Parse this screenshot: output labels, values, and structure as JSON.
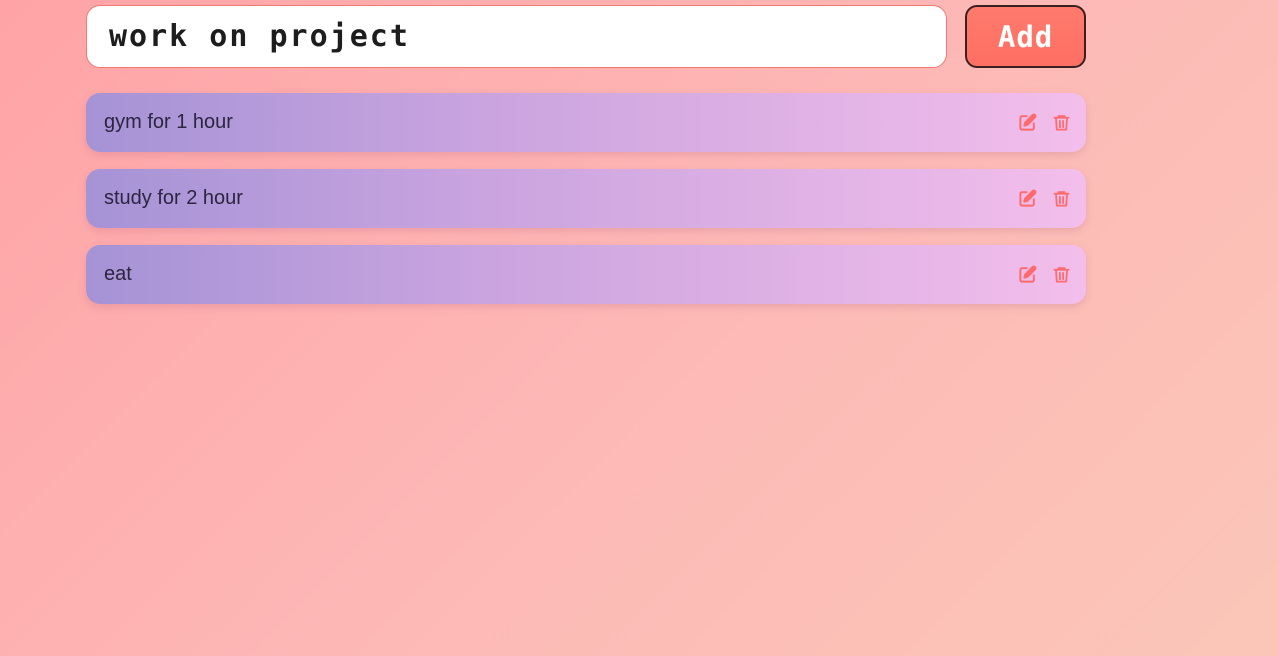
{
  "input": {
    "value": "work on project",
    "placeholder": ""
  },
  "add_button": {
    "label": "Add"
  },
  "tasks": [
    {
      "text": "gym for 1 hour",
      "edit_icon": "edit-icon",
      "delete_icon": "trash-icon"
    },
    {
      "text": "study for 2 hour",
      "edit_icon": "edit-icon",
      "delete_icon": "trash-icon"
    },
    {
      "text": "eat",
      "edit_icon": "edit-icon",
      "delete_icon": "trash-icon"
    }
  ],
  "colors": {
    "background_start": "#ffa3a6",
    "background_end": "#fbc6b8",
    "accent": "#ff6f63",
    "task_gradient_start": "#a593d6",
    "task_gradient_end": "#f3beeb",
    "icon_color": "#ff6a6a"
  }
}
